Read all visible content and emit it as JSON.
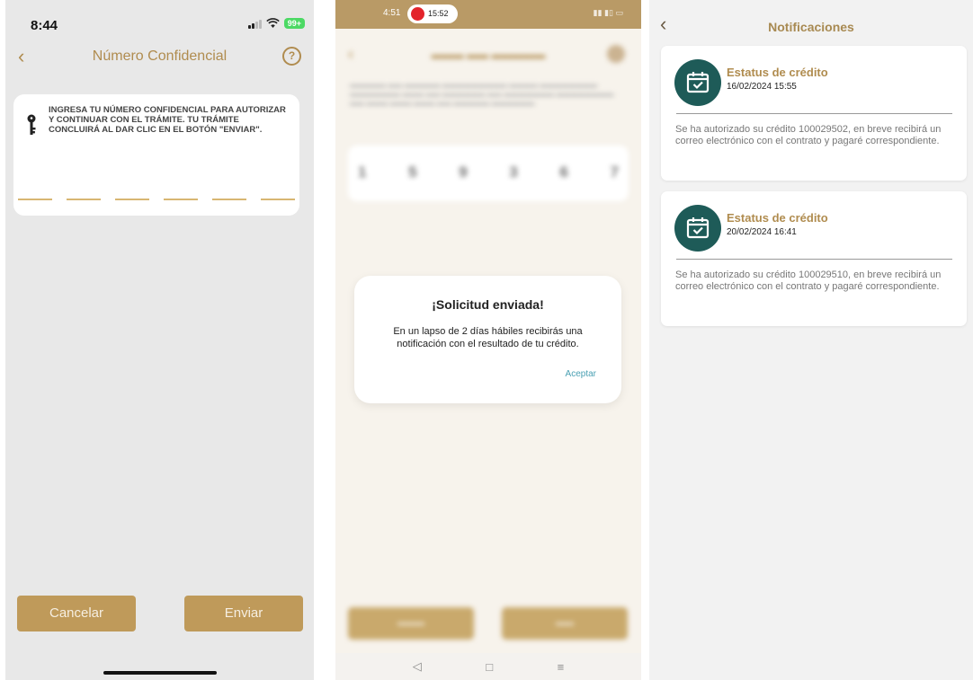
{
  "screen1": {
    "status": {
      "time": "8:44",
      "battery": "99+"
    },
    "nav": {
      "title": "Número Confidencial",
      "help_icon": "question-circle-icon"
    },
    "card": {
      "instructions": "INGRESA TU NÚMERO CONFIDENCIAL PARA AUTORIZAR Y CONTINUAR CON EL TRÁMITE. TU TRÁMITE CONCLUIRÁ AL DAR CLIC EN EL BOTÓN \"ENVIAR\".",
      "pin_slots": 6
    },
    "buttons": {
      "cancel": "Cancelar",
      "send": "Enviar"
    },
    "accent": "#bf9a5a"
  },
  "screen2": {
    "status": {
      "time": "4:51",
      "recording_time": "15:52"
    },
    "background": {
      "digits": [
        "1",
        "5",
        "9",
        "3",
        "6",
        "7"
      ]
    },
    "dialog": {
      "title": "¡Solicitud enviada!",
      "body": "En un lapso de 2 días hábiles recibirás una notificación con el resultado de tu crédito.",
      "accept": "Aceptar"
    },
    "nav_icons": [
      "back-triangle-icon",
      "home-square-icon",
      "menu-lines-icon"
    ]
  },
  "screen3": {
    "nav": {
      "title": "Notificaciones"
    },
    "notifications": [
      {
        "title": "Estatus de crédito",
        "date": "16/02/2024 15:55",
        "body": "Se ha autorizado su crédito 100029502, en breve recibirá un correo electrónico con el contrato y pagaré correspondiente.",
        "icon": "calendar-check-icon"
      },
      {
        "title": "Estatus de crédito",
        "date": "20/02/2024 16:41",
        "body": "Se ha autorizado su crédito 100029510, en breve recibirá un correo electrónico con el contrato y pagaré correspondiente.",
        "icon": "calendar-check-icon"
      }
    ],
    "icon_bg": "#1e5b58"
  }
}
